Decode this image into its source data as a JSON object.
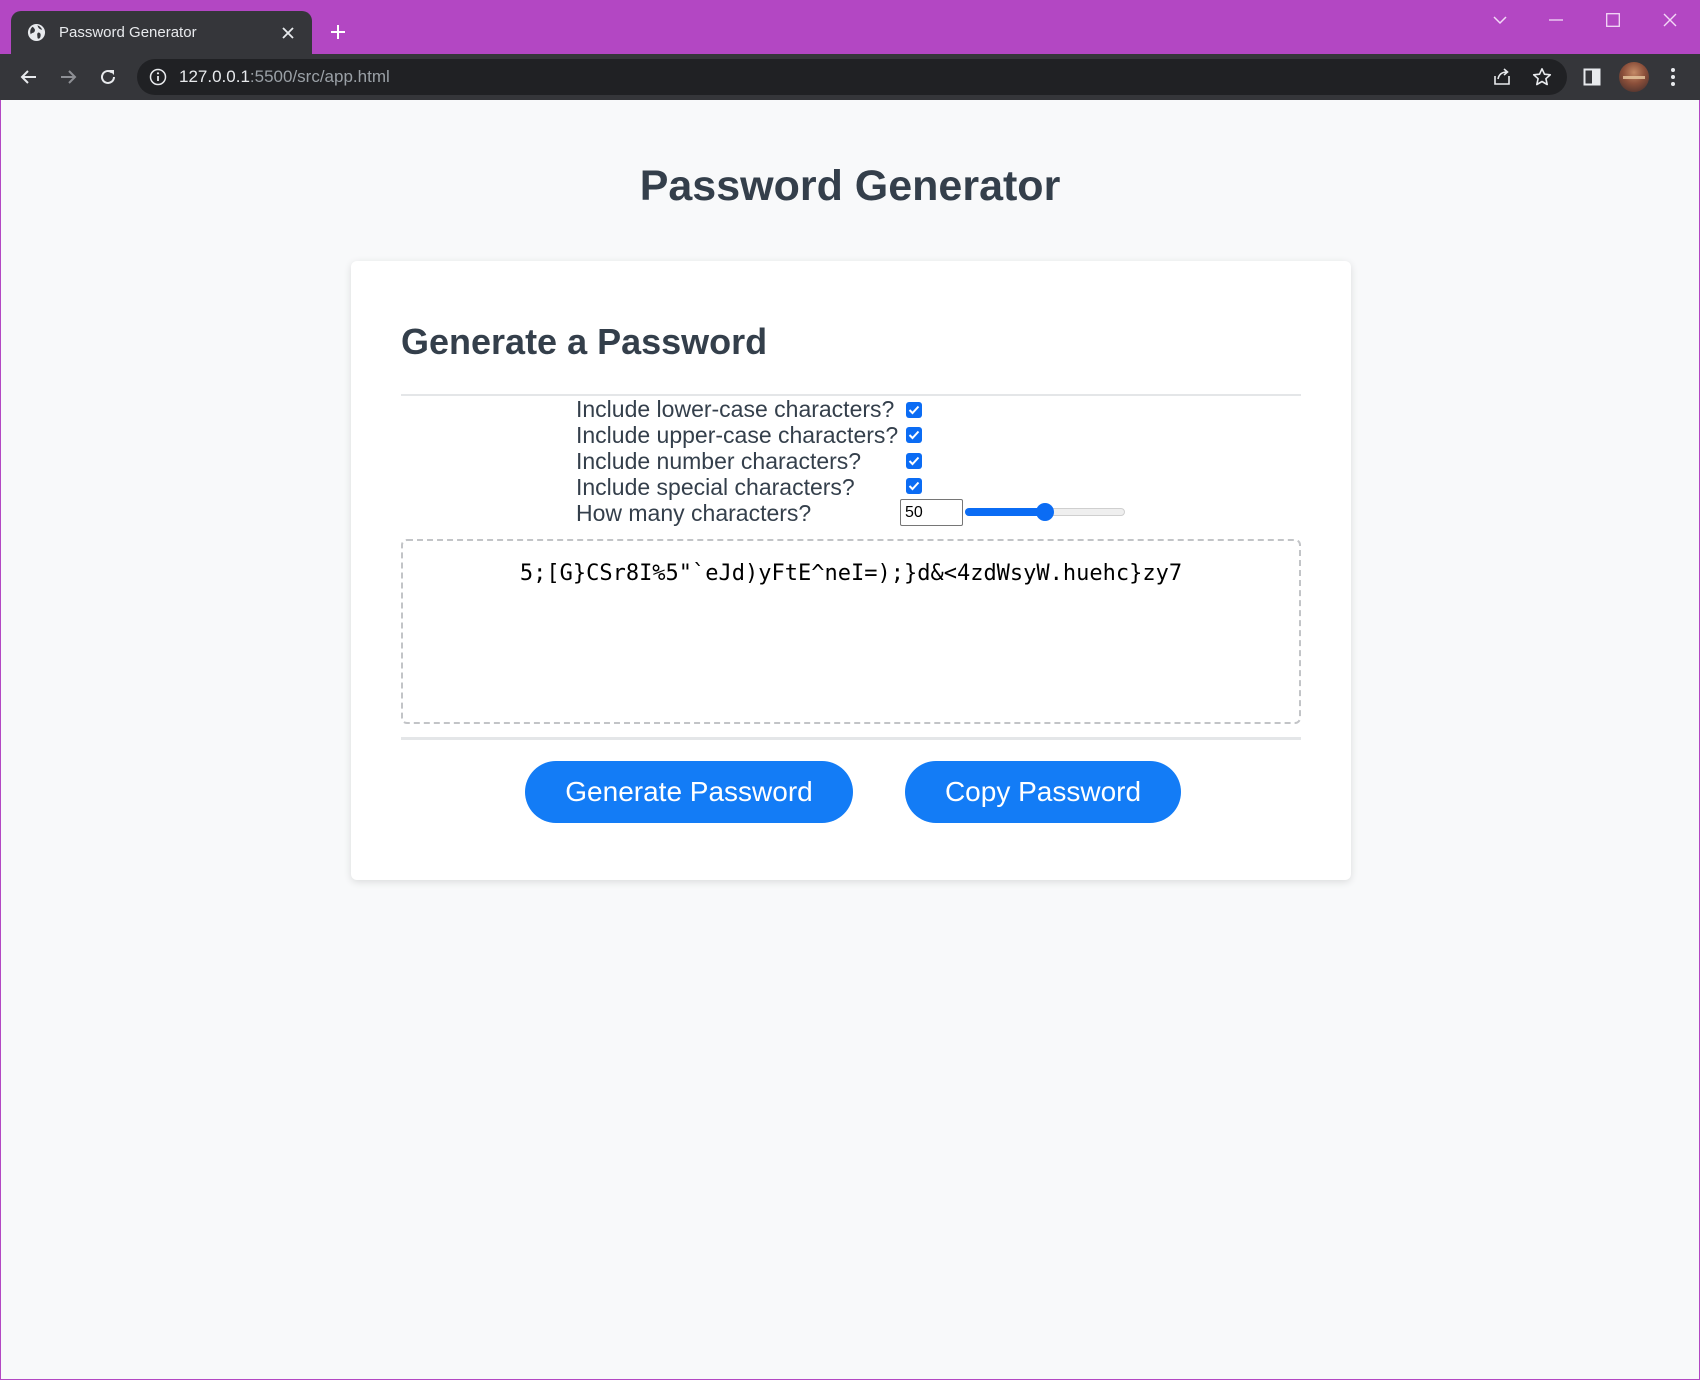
{
  "browser": {
    "tab_title": "Password Generator",
    "url_host": "127.0.0.1",
    "url_rest": ":5500/src/app.html",
    "theme_color": "#b347c3"
  },
  "page": {
    "title": "Password Generator",
    "card_header": "Generate a Password",
    "options": [
      {
        "label": "Include lower-case characters?",
        "checked": true
      },
      {
        "label": "Include upper-case characters?",
        "checked": true
      },
      {
        "label": "Include number characters?",
        "checked": true
      },
      {
        "label": "Include special characters?",
        "checked": true
      }
    ],
    "length_label": "How many characters?",
    "length_value": "50",
    "slider_fraction": 0.5,
    "password": "5;[G}CSr8I%5\"`eJd)yFtE^neI=);}d&<4zdWsyW.huehc}zy7",
    "generate_button": "Generate Password",
    "copy_button": "Copy Password",
    "accent_color": "#137cf6"
  }
}
